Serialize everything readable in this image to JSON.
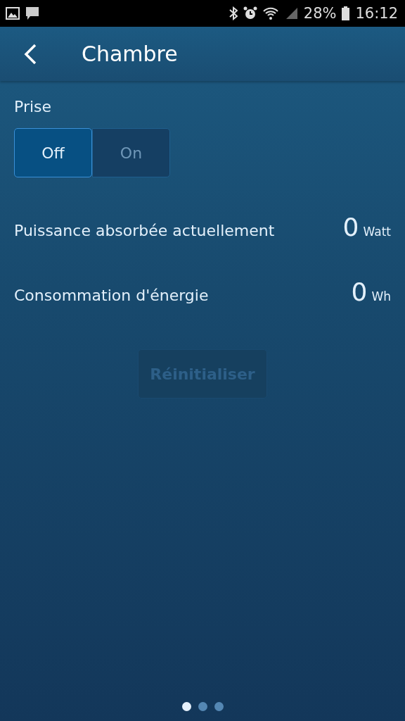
{
  "status_bar": {
    "battery": "28%",
    "time": "16:12"
  },
  "app_bar": {
    "title": "Chambre"
  },
  "socket": {
    "label": "Prise",
    "options": [
      {
        "label": "Off",
        "selected": true
      },
      {
        "label": "On",
        "selected": false
      }
    ]
  },
  "readings": [
    {
      "label": "Puissance absorbée actuellement",
      "value": "0",
      "unit": "Watt"
    },
    {
      "label": "Consommation d'énergie",
      "value": "0",
      "unit": "Wh"
    }
  ],
  "reset_button": {
    "label": "Réinitialiser",
    "disabled": true
  },
  "page_dots": [
    {
      "selected": true
    },
    {
      "selected": false
    },
    {
      "selected": false
    }
  ]
}
